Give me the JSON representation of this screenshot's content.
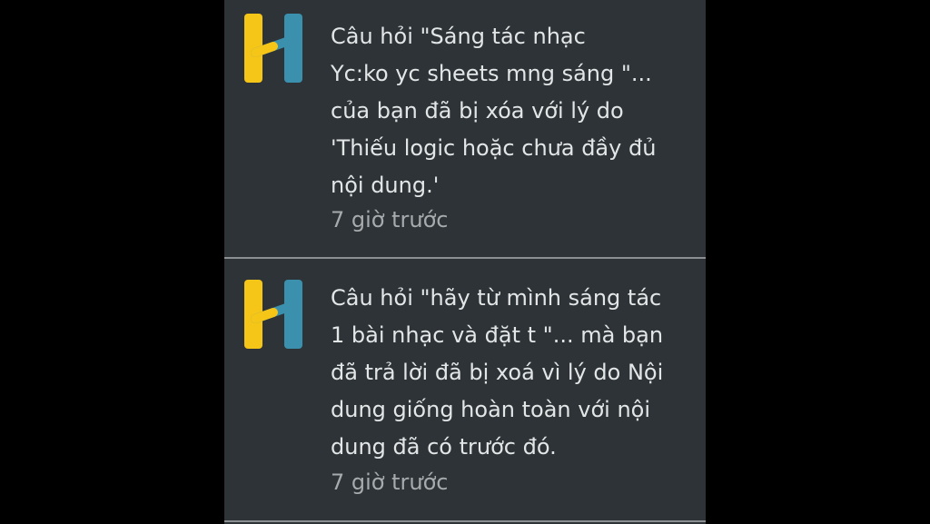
{
  "notifications": [
    {
      "logo_icon": "hoc24-h-logo-icon",
      "message": "Câu hỏi \"Sáng tác nhạc\nYc:ko yc sheets mng sáng  \"...\ncủa bạn đã bị xóa với lý do\n'Thiếu logic hoặc chưa đầy đủ\nnội dung.'",
      "time": "7 giờ trước"
    },
    {
      "logo_icon": "hoc24-h-logo-icon",
      "message": "Câu hỏi \"hãy từ mình sáng tác\n1 bài nhạc và đặt t \"... mà bạn\nđã trả lời đã bị xoá vì lý do Nội\ndung giống hoàn toàn với nội\ndung đã có trước đó.",
      "time": "7 giờ trước"
    }
  ],
  "colors": {
    "background": "#000000",
    "panel": "#2d3336",
    "text": "#e3e6e7",
    "muted_text": "#a7abad",
    "logo_yellow": "#f5c518",
    "logo_blue": "#3b91ad"
  }
}
